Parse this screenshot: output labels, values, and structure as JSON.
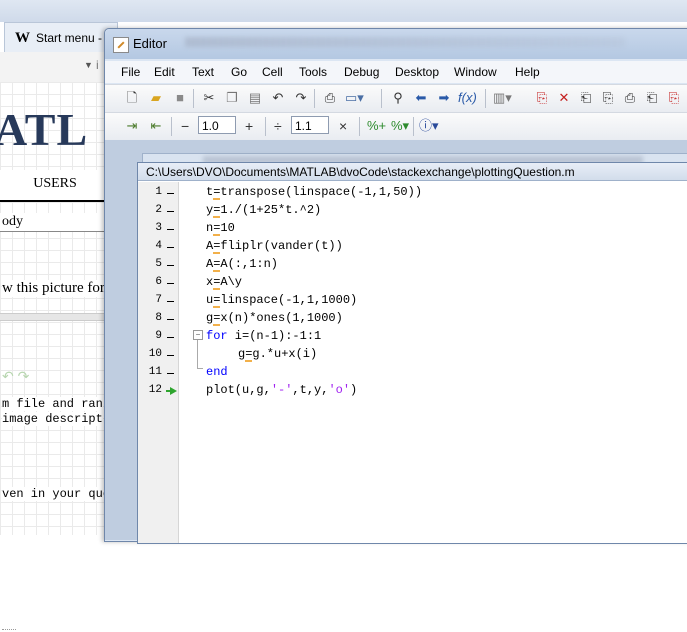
{
  "background_window": {
    "tab_title": "Start menu -",
    "tab_icon": "W",
    "toolbar_letter": "i",
    "logo_text": "ATL",
    "users_tab": "USERS",
    "body_field": "ody",
    "picture_text": "w this picture for",
    "code_text_line1": "m file and ran",
    "code_text_line2": " image descript",
    "code_text_line3": "ven in your que"
  },
  "editor": {
    "title": "Editor",
    "menu": [
      "File",
      "Edit",
      "Text",
      "Go",
      "Cell",
      "Tools",
      "Debug",
      "Desktop",
      "Window",
      "Help"
    ],
    "toolbar2": {
      "minus": "−",
      "cell_height": "1.0",
      "plus": "+",
      "divide": "÷",
      "cell_width": "1.1",
      "times": "×"
    },
    "document": {
      "path": "C:\\Users\\DVO\\Documents\\MATLAB\\dvoCode\\stackexchange\\plottingQuestion.m",
      "lines": [
        {
          "num": "1",
          "code": "t=transpose(linspace(-1,1,50))"
        },
        {
          "num": "2",
          "code": "y=1./(1+25*t.^2)"
        },
        {
          "num": "3",
          "code": "n=10"
        },
        {
          "num": "4",
          "code": "A=fliplr(vander(t))"
        },
        {
          "num": "5",
          "code": "A=A(:,1:n)"
        },
        {
          "num": "6",
          "code": "x=A\\y"
        },
        {
          "num": "7",
          "code": "u=linspace(-1,1,1000)"
        },
        {
          "num": "8",
          "code": "g=x(n)*ones(1,1000)"
        },
        {
          "num": "9",
          "code_kw": "for",
          "code": " i=(n-1):-1:1"
        },
        {
          "num": "10",
          "code": "g=g.*u+x(i)"
        },
        {
          "num": "11",
          "code_kw": "end",
          "code": ""
        },
        {
          "num": "12",
          "code_pre": "plot(u,g,",
          "code_str1": "'-'",
          "code_mid": ",t,y,",
          "code_str2": "'o'",
          "code_post": ")"
        }
      ]
    }
  },
  "colors": {
    "keyword": "#0000ff",
    "string": "#a020f0",
    "mlint_marker": "#f2b04a",
    "exec_arrow": "#2ea52e"
  }
}
